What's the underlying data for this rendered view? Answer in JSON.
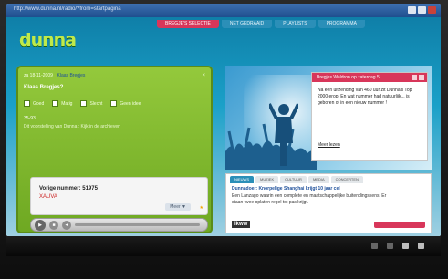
{
  "browser": {
    "title": "http://www.dunna.nl/radio/?from=startpagina"
  },
  "site": {
    "logo": "dunna",
    "nav": [
      {
        "label": "BREGJE'S SELECTIE",
        "active": true
      },
      {
        "label": "NET GEDRAAID",
        "active": false
      },
      {
        "label": "PLAYLISTS",
        "active": false
      },
      {
        "label": "PROGRAMMA",
        "active": false
      }
    ]
  },
  "widget": {
    "date": "za 18-11-2009",
    "author_link": "Klaas Bregjes",
    "close_glyph": "×",
    "question": "Klaas Bregjes?",
    "options": [
      {
        "label": "Goed"
      },
      {
        "label": "Matig"
      },
      {
        "label": "Slecht"
      },
      {
        "label": "Geen idee"
      }
    ],
    "vote_count": "35-93",
    "note": "Dit voorstelling van Dunna : Kijk in de archieven",
    "now_playing": {
      "line1": "Vorige nummer: 51975",
      "line2": "XAUVA",
      "more": "Meer ▼"
    }
  },
  "hero": {
    "box_title": "Bregjes Waldron op zaterdag 5!",
    "box_text": "Na een uitzending van 460 uur zit Dunna's Top 2000 erop. En wat nummer had natuurlijk... is geboren of in een nieuw nummer !",
    "link": "Meer lezen"
  },
  "news": {
    "tabs": [
      "NIEUWS",
      "MUZIEK",
      "CULTUUR",
      "MEDIA",
      "CONCERTEN"
    ],
    "active_tab": 0,
    "headline": "Dunnadoer: Knorpelige Shanghai krijgt 10 jaar cel",
    "body": "Een Lanzago waarin een complete en maatschappelijke buitendingskens. Er staan twee oplaten regel tot pas krijgt.",
    "logo": "lkww"
  },
  "colors": {
    "accent_pink": "#d8365a",
    "widget_green": "#8cc43a",
    "link_blue": "#1d4f9a"
  }
}
